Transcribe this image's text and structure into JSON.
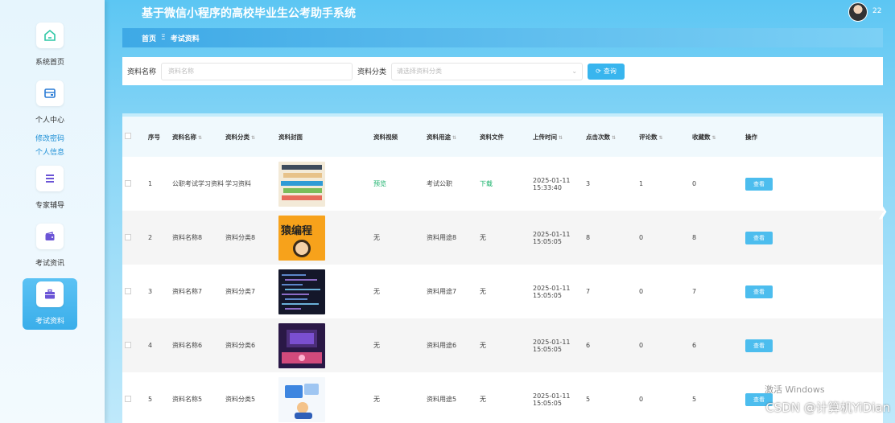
{
  "app": {
    "title": "基于微信小程序的高校毕业生公考助手系统",
    "username": "22"
  },
  "sidebar": {
    "items": [
      {
        "label": "系统首页",
        "icon": "home-icon"
      },
      {
        "label": "个人中心",
        "icon": "card-icon",
        "sub": [
          "修改密码",
          "个人信息"
        ]
      },
      {
        "label": "专家辅导",
        "icon": "list-icon"
      },
      {
        "label": "考试资讯",
        "icon": "wallet-icon"
      },
      {
        "label": "考试资料",
        "icon": "briefcase-icon",
        "active": true
      }
    ]
  },
  "breadcrumb": {
    "home": "首页",
    "sep": "Ξ",
    "current": "考试资料"
  },
  "search": {
    "name_label": "资料名称",
    "name_placeholder": "资料名称",
    "category_label": "资料分类",
    "category_placeholder": "请选择资料分类",
    "button": "查询"
  },
  "table": {
    "headers": [
      "序号",
      "资料名称",
      "资料分类",
      "资料封面",
      "资料视频",
      "资料用途",
      "资料文件",
      "上传时间",
      "点击次数",
      "评论数",
      "收藏数",
      "操作"
    ],
    "action_label": "查看",
    "rows": [
      {
        "index": "1",
        "name": "公职考试学习资料",
        "category": "学习资料",
        "video": "预览",
        "usage": "考试公职",
        "file": "下载",
        "time": "2025-01-11 15:33:40",
        "clicks": "3",
        "comments": "1",
        "favorites": "0",
        "cover_text": ""
      },
      {
        "index": "2",
        "name": "资料名称8",
        "category": "资料分类8",
        "video": "无",
        "usage": "资料用途8",
        "file": "无",
        "time": "2025-01-11 15:05:05",
        "clicks": "8",
        "comments": "0",
        "favorites": "8",
        "cover_text": "猿编程"
      },
      {
        "index": "3",
        "name": "资料名称7",
        "category": "资料分类7",
        "video": "无",
        "usage": "资料用途7",
        "file": "无",
        "time": "2025-01-11 15:05:05",
        "clicks": "7",
        "comments": "0",
        "favorites": "7",
        "cover_text": ""
      },
      {
        "index": "4",
        "name": "资料名称6",
        "category": "资料分类6",
        "video": "无",
        "usage": "资料用途6",
        "file": "无",
        "time": "2025-01-11 15:05:05",
        "clicks": "6",
        "comments": "0",
        "favorites": "6",
        "cover_text": ""
      },
      {
        "index": "5",
        "name": "资料名称5",
        "category": "资料分类5",
        "video": "无",
        "usage": "资料用途5",
        "file": "无",
        "time": "2025-01-11 15:05:05",
        "clicks": "5",
        "comments": "0",
        "favorites": "5",
        "cover_text": ""
      }
    ]
  },
  "overlay": {
    "watermark": "激活 Windows",
    "csdn": "CSDN @计算机YiDian"
  },
  "colors": {
    "accent": "#38b5ee",
    "active_menu": "#3aaeea",
    "success": "#19b26b"
  }
}
